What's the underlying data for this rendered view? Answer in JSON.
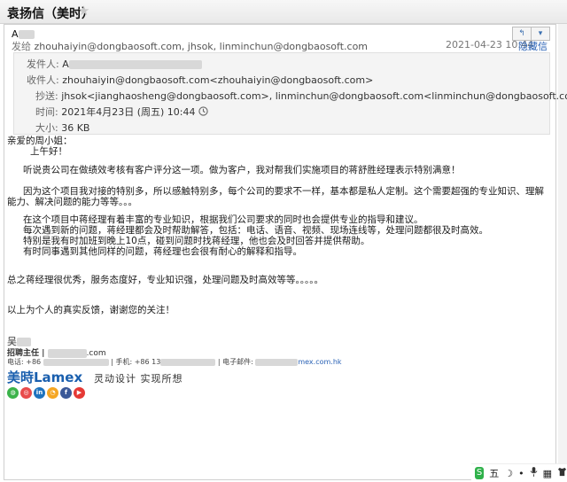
{
  "titlebar": {
    "subject": "袁扬信（美时）",
    "star": "★"
  },
  "message": {
    "sender_short": "A",
    "send_to_label": "发给",
    "send_to": "zhouhaiyin@dongbaosoft.com, jhsok, linminchun@dongbaosoft.com",
    "date": "2021-04-23 10:44",
    "hide_info": "隐藏信息",
    "buttons": {
      "reply": "↰",
      "more": "▾"
    }
  },
  "header": {
    "from_label": "发件人:",
    "from_value": "A",
    "to_label": "收件人:",
    "to_value": "zhouhaiyin@dongbaosoft.com<zhouhaiyin@dongbaosoft.com>",
    "cc_label": "抄送:",
    "cc_value": "jhsok<jianghaosheng@dongbaosoft.com>,   linminchun@dongbaosoft.com<linminchun@dongbaosoft.com>",
    "time_label": "时间:",
    "time_value": "2021年4月23日 (周五) 10:44",
    "size_label": "大小:",
    "size_value": "36 KB",
    "clock_icon": "clock-icon"
  },
  "body": {
    "greeting": "亲爱的周小姐：",
    "morning": "上午好！",
    "p1": "听说贵公司在做绩效考核有客户评分这一项。做为客户，我对帮我们实施项目的蒋舒胜经理表示特别满意！",
    "p2": "因为这个项目我对接的特别多，所以感触特别多，每个公司的要求不一样，基本都是私人定制。这个需要超强的专业知识、理解能力、解决问题的能力等等。。。",
    "p3a": "在这个项目中蒋经理有着丰富的专业知识，根据我们公司要求的同时也会提供专业的指导和建议。",
    "p3b": "每次遇到新的问题，蒋经理都会及时帮助解答，包括：电话、语音、视频、现场连线等，处理问题都很及时高效。",
    "p3c": "特别是我有时加班到晚上10点，碰到问题时找蒋经理，他也会及时回答并提供帮助。",
    "p3d": "有时同事遇到其他同样的问题，蒋经理也会很有耐心的解释和指导。",
    "p4": "总之蒋经理很优秀，服务态度好，专业知识强，处理问题及时高效等等。。。。。",
    "p5": "以上为个人的真实反馈，谢谢您的关注！"
  },
  "signature": {
    "name": "吴",
    "role": "招聘主任 |",
    "role_tail": ".com",
    "contact_phone_label": "电话: +86",
    "contact_mobile_label": "| 手机: +86 13",
    "contact_email_label": "| 电子邮件: ",
    "contact_email_tail": "mex.com.hk",
    "brand": "美時Lamex",
    "slogan": "灵动设计 实现所想"
  },
  "tray": {
    "ime": "五",
    "moon": "☽",
    "dot": "•",
    "mic": "🎤",
    "grid": "▦",
    "person": "👕"
  }
}
